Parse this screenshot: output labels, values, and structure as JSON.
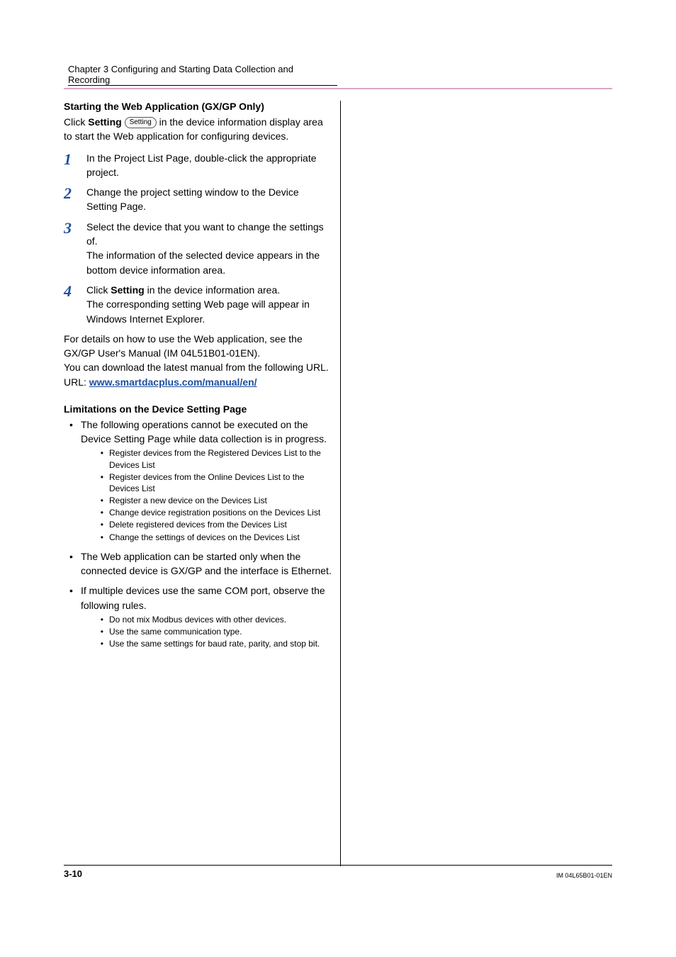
{
  "chapter_title": "Chapter 3  Configuring and Starting Data Collection and Recording",
  "heading1": "Starting the Web Application (GX/GP Only)",
  "intro_pre": "Click ",
  "intro_bold": "Setting",
  "intro_btn": "Setting",
  "intro_post": " in the device information display area to start the Web application for configuring devices.",
  "steps": [
    {
      "n": "1",
      "t": "In the Project List Page, double-click the appropriate project."
    },
    {
      "n": "2",
      "t": "Change the project setting window to the Device Setting Page."
    },
    {
      "n": "3",
      "t": "Select the device that you want to change the settings of.",
      "t2": "The information of the selected device appears in the bottom device information area."
    },
    {
      "n": "4",
      "pre": "Click ",
      "bold": "Setting",
      "post": " in the device information area.",
      "t2": "The corresponding setting Web page will appear in Windows Internet Explorer."
    }
  ],
  "note1": "For details on how to use the Web application, see the GX/GP User's Manual (IM 04L51B01-01EN).",
  "note2": "You can download the latest manual from the following URL.",
  "url_label": "URL: ",
  "url_link": "www.smartdacplus.com/manual/en/",
  "heading2": "Limitations on the Device Setting Page",
  "lim1": "The following operations cannot be executed on the Device Setting Page while data collection is in progress.",
  "lim1_sub": [
    "Register devices from the Registered Devices List to the Devices List",
    "Register devices from the Online Devices List to the Devices List",
    "Register a new device on the Devices List",
    "Change device registration positions on the Devices List",
    "Delete registered devices from the Devices List",
    "Change the settings of devices on the Devices List"
  ],
  "lim2": "The Web application can be started only when the connected device is GX/GP and the interface is Ethernet.",
  "lim3": "If multiple devices use the same COM port, observe the following rules.",
  "lim3_sub": [
    "Do not mix Modbus devices with other devices.",
    "Use the same communication type.",
    "Use the same settings for baud rate, parity, and stop bit."
  ],
  "page_number": "3-10",
  "doc_id": "IM 04L65B01-01EN"
}
